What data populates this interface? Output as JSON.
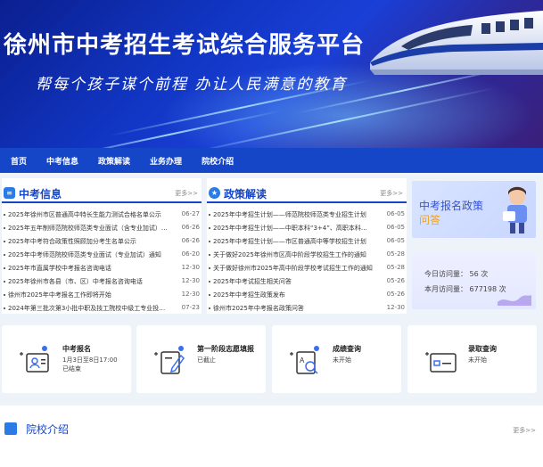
{
  "banner": {
    "title": "徐州市中考招生考试综合服务平台",
    "slogan": "帮每个孩子谋个前程  办让人民满意的教育"
  },
  "nav": {
    "items": [
      "首页",
      "中考信息",
      "政策解读",
      "业务办理",
      "院校介绍"
    ]
  },
  "news": {
    "title": "中考信息",
    "more": "更多>>",
    "items": [
      {
        "text": "2025年徐州市区普通高中特长生能力测试合格名单公示",
        "date": "06-27"
      },
      {
        "text": "2025年五年制师范院校师范类专业面试（含专业加试）…",
        "date": "06-26"
      },
      {
        "text": "2025年中考符合政策性照顾加分考生名单公示",
        "date": "06-26"
      },
      {
        "text": "2025年中考师范院校师范类专业面试（专业加试）通知",
        "date": "06-20"
      },
      {
        "text": "2025年市直属学校中考报名咨询电话",
        "date": "12-30"
      },
      {
        "text": "2025年徐州市各县（市、区）中考报名咨询电话",
        "date": "12-30"
      },
      {
        "text": "徐州市2025年中考报名工作即将开始",
        "date": "12-30"
      },
      {
        "text": "2024年第三批次第3小批中职及技工院校中级工专业投…",
        "date": "07-23"
      }
    ]
  },
  "policy": {
    "title": "政策解读",
    "more": "更多>>",
    "items": [
      {
        "text": "2025年中考招生计划——师范院校师范类专业招生计划",
        "date": "06-05"
      },
      {
        "text": "2025年中考招生计划——中职本科“3+4”、高职本科…",
        "date": "06-05"
      },
      {
        "text": "2025年中考招生计划——市区普通高中等学校招生计划",
        "date": "06-05"
      },
      {
        "text": "关于做好2025年徐州市区高中阶段学校招生工作的通知",
        "date": "05-28"
      },
      {
        "text": "关于做好徐州市2025年高中阶段学校考试招生工作的通知",
        "date": "05-28"
      },
      {
        "text": "2025年中考试招生相关问答",
        "date": "05-26"
      },
      {
        "text": "2025年中考招生政策发布",
        "date": "05-26"
      },
      {
        "text": "徐州市2025年中考报名政策问答",
        "date": "12-30"
      }
    ]
  },
  "promo": {
    "line1": "中考报名政策",
    "line2": "问答"
  },
  "stats": {
    "today": "今日访问量：  56 次",
    "month": "本月访问量：  677198 次"
  },
  "cards": [
    {
      "title": "中考报名",
      "sub1": "1月3日至8日17:00",
      "sub2": "已结束",
      "icon": "registration-card-icon"
    },
    {
      "title": "第一阶段志愿填报",
      "sub1": "已截止",
      "sub2": "",
      "icon": "pen-form-icon"
    },
    {
      "title": "成绩查询",
      "sub1": "未开始",
      "sub2": "",
      "icon": "search-document-icon"
    },
    {
      "title": "录取查询",
      "sub1": "未开始",
      "sub2": "",
      "icon": "admission-card-icon"
    }
  ],
  "school": {
    "title": "院校介绍",
    "more": "更多>>"
  },
  "colors": {
    "primary": "#1446c7",
    "accent": "#2b7be5",
    "highlight": "#f0a020"
  }
}
